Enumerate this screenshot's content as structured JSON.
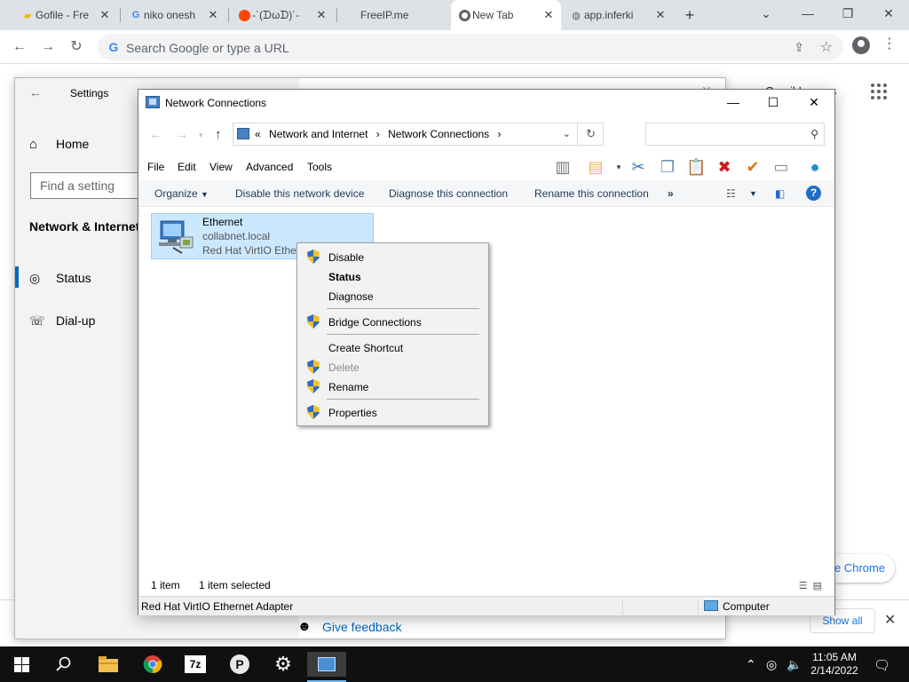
{
  "browser": {
    "tabs": [
      {
        "label": "Gofile - Fre",
        "icon": "folder-icon"
      },
      {
        "label": "niko onesh",
        "icon": "google-icon"
      },
      {
        "label": "-`(ᗪωᗪ)´-",
        "icon": "reddit-icon"
      },
      {
        "label": "FreeIP.me",
        "icon": "page-icon"
      },
      {
        "label": "New Tab",
        "icon": "chrome-icon"
      },
      {
        "label": "app.inferki",
        "icon": "globe-icon"
      }
    ],
    "active_tab": 4,
    "omnibox_placeholder": "Search Google or type a URL",
    "bg_images_link": "Gmail  Images",
    "bg_chrome_pill": "e Chrome",
    "show_all": "Show all"
  },
  "settings": {
    "title": "Settings",
    "home": "Home",
    "search_placeholder": "Find a setting",
    "section": "Network & Internet",
    "nav": [
      {
        "label": "Status",
        "icon": "globe-status-icon"
      },
      {
        "label": "Dial-up",
        "icon": "dialup-icon"
      }
    ],
    "feedback": "Give feedback"
  },
  "network": {
    "title": "Network Connections",
    "breadcrumb": [
      "Network and Internet",
      "Network Connections"
    ],
    "menus": [
      "File",
      "Edit",
      "View",
      "Advanced",
      "Tools"
    ],
    "commands": {
      "organize": "Organize",
      "disable": "Disable this network device",
      "diagnose": "Diagnose this connection",
      "rename": "Rename this connection",
      "more": "»"
    },
    "item": {
      "name": "Ethernet",
      "domain": "collabnet.local",
      "adapter": "Red Hat VirtIO Ethernet Adapter"
    },
    "status": {
      "count": "1 item",
      "selected": "1 item selected",
      "detail": "Red Hat VirtIO Ethernet Adapter",
      "location": "Computer"
    }
  },
  "context_menu": {
    "items": [
      {
        "label": "Disable",
        "shield": true
      },
      {
        "label": "Status",
        "bold": true
      },
      {
        "label": "Diagnose"
      },
      {
        "label": "Bridge Connections",
        "shield": true
      },
      {
        "label": "Create Shortcut"
      },
      {
        "label": "Delete",
        "shield": true,
        "disabled": true
      },
      {
        "label": "Rename",
        "shield": true
      },
      {
        "label": "Properties",
        "shield": true
      }
    ]
  },
  "taskbar": {
    "time": "11:05 AM",
    "date": "2/14/2022"
  },
  "colors": {
    "selection": "#cce8ff",
    "accent": "#0067c0",
    "taskbar": "#101010"
  }
}
